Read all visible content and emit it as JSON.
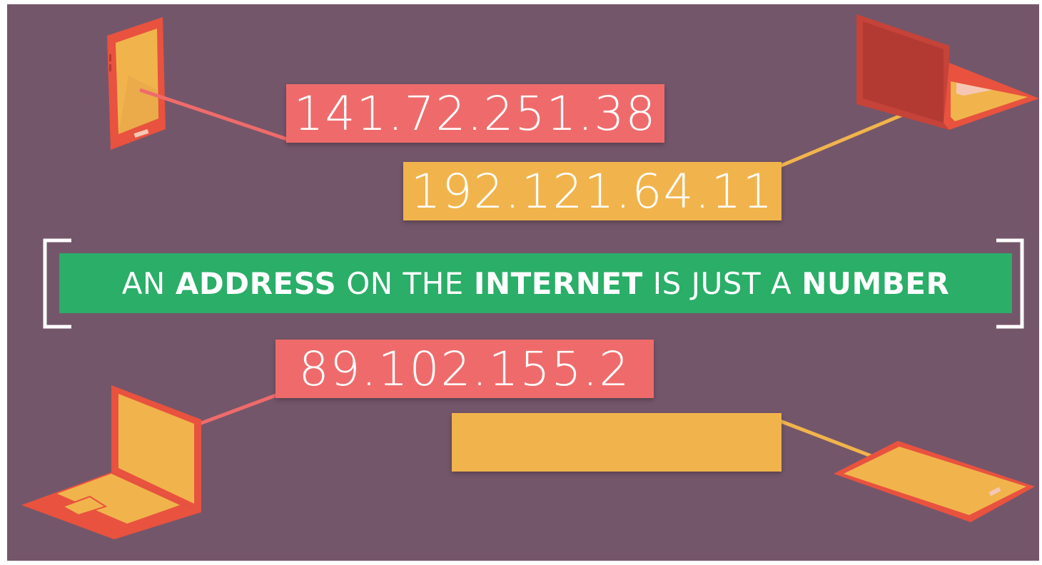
{
  "ip_addresses": {
    "top_red": "141.72.251.38",
    "top_yellow": "192.121.64.11",
    "bottom_red": "89.102.155.2",
    "bottom_yellow": ""
  },
  "banner": {
    "w1": "AN",
    "w2": "ADDRESS",
    "w3": "ON THE",
    "w4": "INTERNET",
    "w5": "IS JUST A",
    "w6": "NUMBER"
  },
  "devices": [
    "phone-icon",
    "laptop-icon",
    "laptop-icon",
    "tablet-icon"
  ],
  "colors": {
    "background": "#74566a",
    "red_box": "#ef6b6b",
    "yellow_box": "#f1b44c",
    "banner": "#2aae68",
    "device_frame": "#e8523f",
    "device_screen": "#f1b44c"
  }
}
